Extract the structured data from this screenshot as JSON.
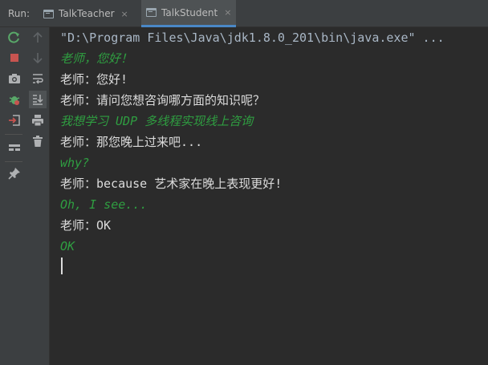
{
  "run_panel": {
    "label": "Run:",
    "tabs": [
      {
        "label": "TalkTeacher",
        "active": false
      },
      {
        "label": "TalkStudent",
        "active": true
      }
    ],
    "close_glyph": "×"
  },
  "toolbar": {
    "buttons": [
      {
        "name": "rerun-icon"
      },
      {
        "name": "stop-icon"
      },
      {
        "name": "camera-icon"
      },
      {
        "name": "debug-icon"
      },
      {
        "name": "exit-icon"
      },
      {
        "name": "layout-icon"
      },
      {
        "name": "pin-icon"
      },
      {
        "name": "up-arrow-icon"
      },
      {
        "name": "down-arrow-icon"
      },
      {
        "name": "soft-wrap-icon"
      },
      {
        "name": "scroll-to-end-icon"
      },
      {
        "name": "print-icon"
      },
      {
        "name": "trash-icon"
      }
    ]
  },
  "console": {
    "lines": [
      {
        "type": "cmd",
        "text": "\"D:\\Program Files\\Java\\jdk1.8.0_201\\bin\\java.exe\" ..."
      },
      {
        "type": "in",
        "text": "老师，您好！"
      },
      {
        "type": "out",
        "text": "老师：您好!"
      },
      {
        "type": "out",
        "text": "老师：请问您想咨询哪方面的知识呢？"
      },
      {
        "type": "in",
        "text": "我想学习 UDP 多线程实现线上咨询"
      },
      {
        "type": "out",
        "text": "老师：那您晚上过来吧..."
      },
      {
        "type": "in",
        "text": "why?"
      },
      {
        "type": "out",
        "text": "老师：because 艺术家在晚上表现更好!"
      },
      {
        "type": "in",
        "text": "Oh, I see..."
      },
      {
        "type": "out",
        "text": "老师：OK"
      },
      {
        "type": "in",
        "text": "OK"
      }
    ]
  },
  "colors": {
    "background": "#2b2b2b",
    "panel": "#3c3f41",
    "output_text": "#dcdcdc",
    "input_text": "#2f9e41",
    "accent": "#4a88c7"
  }
}
